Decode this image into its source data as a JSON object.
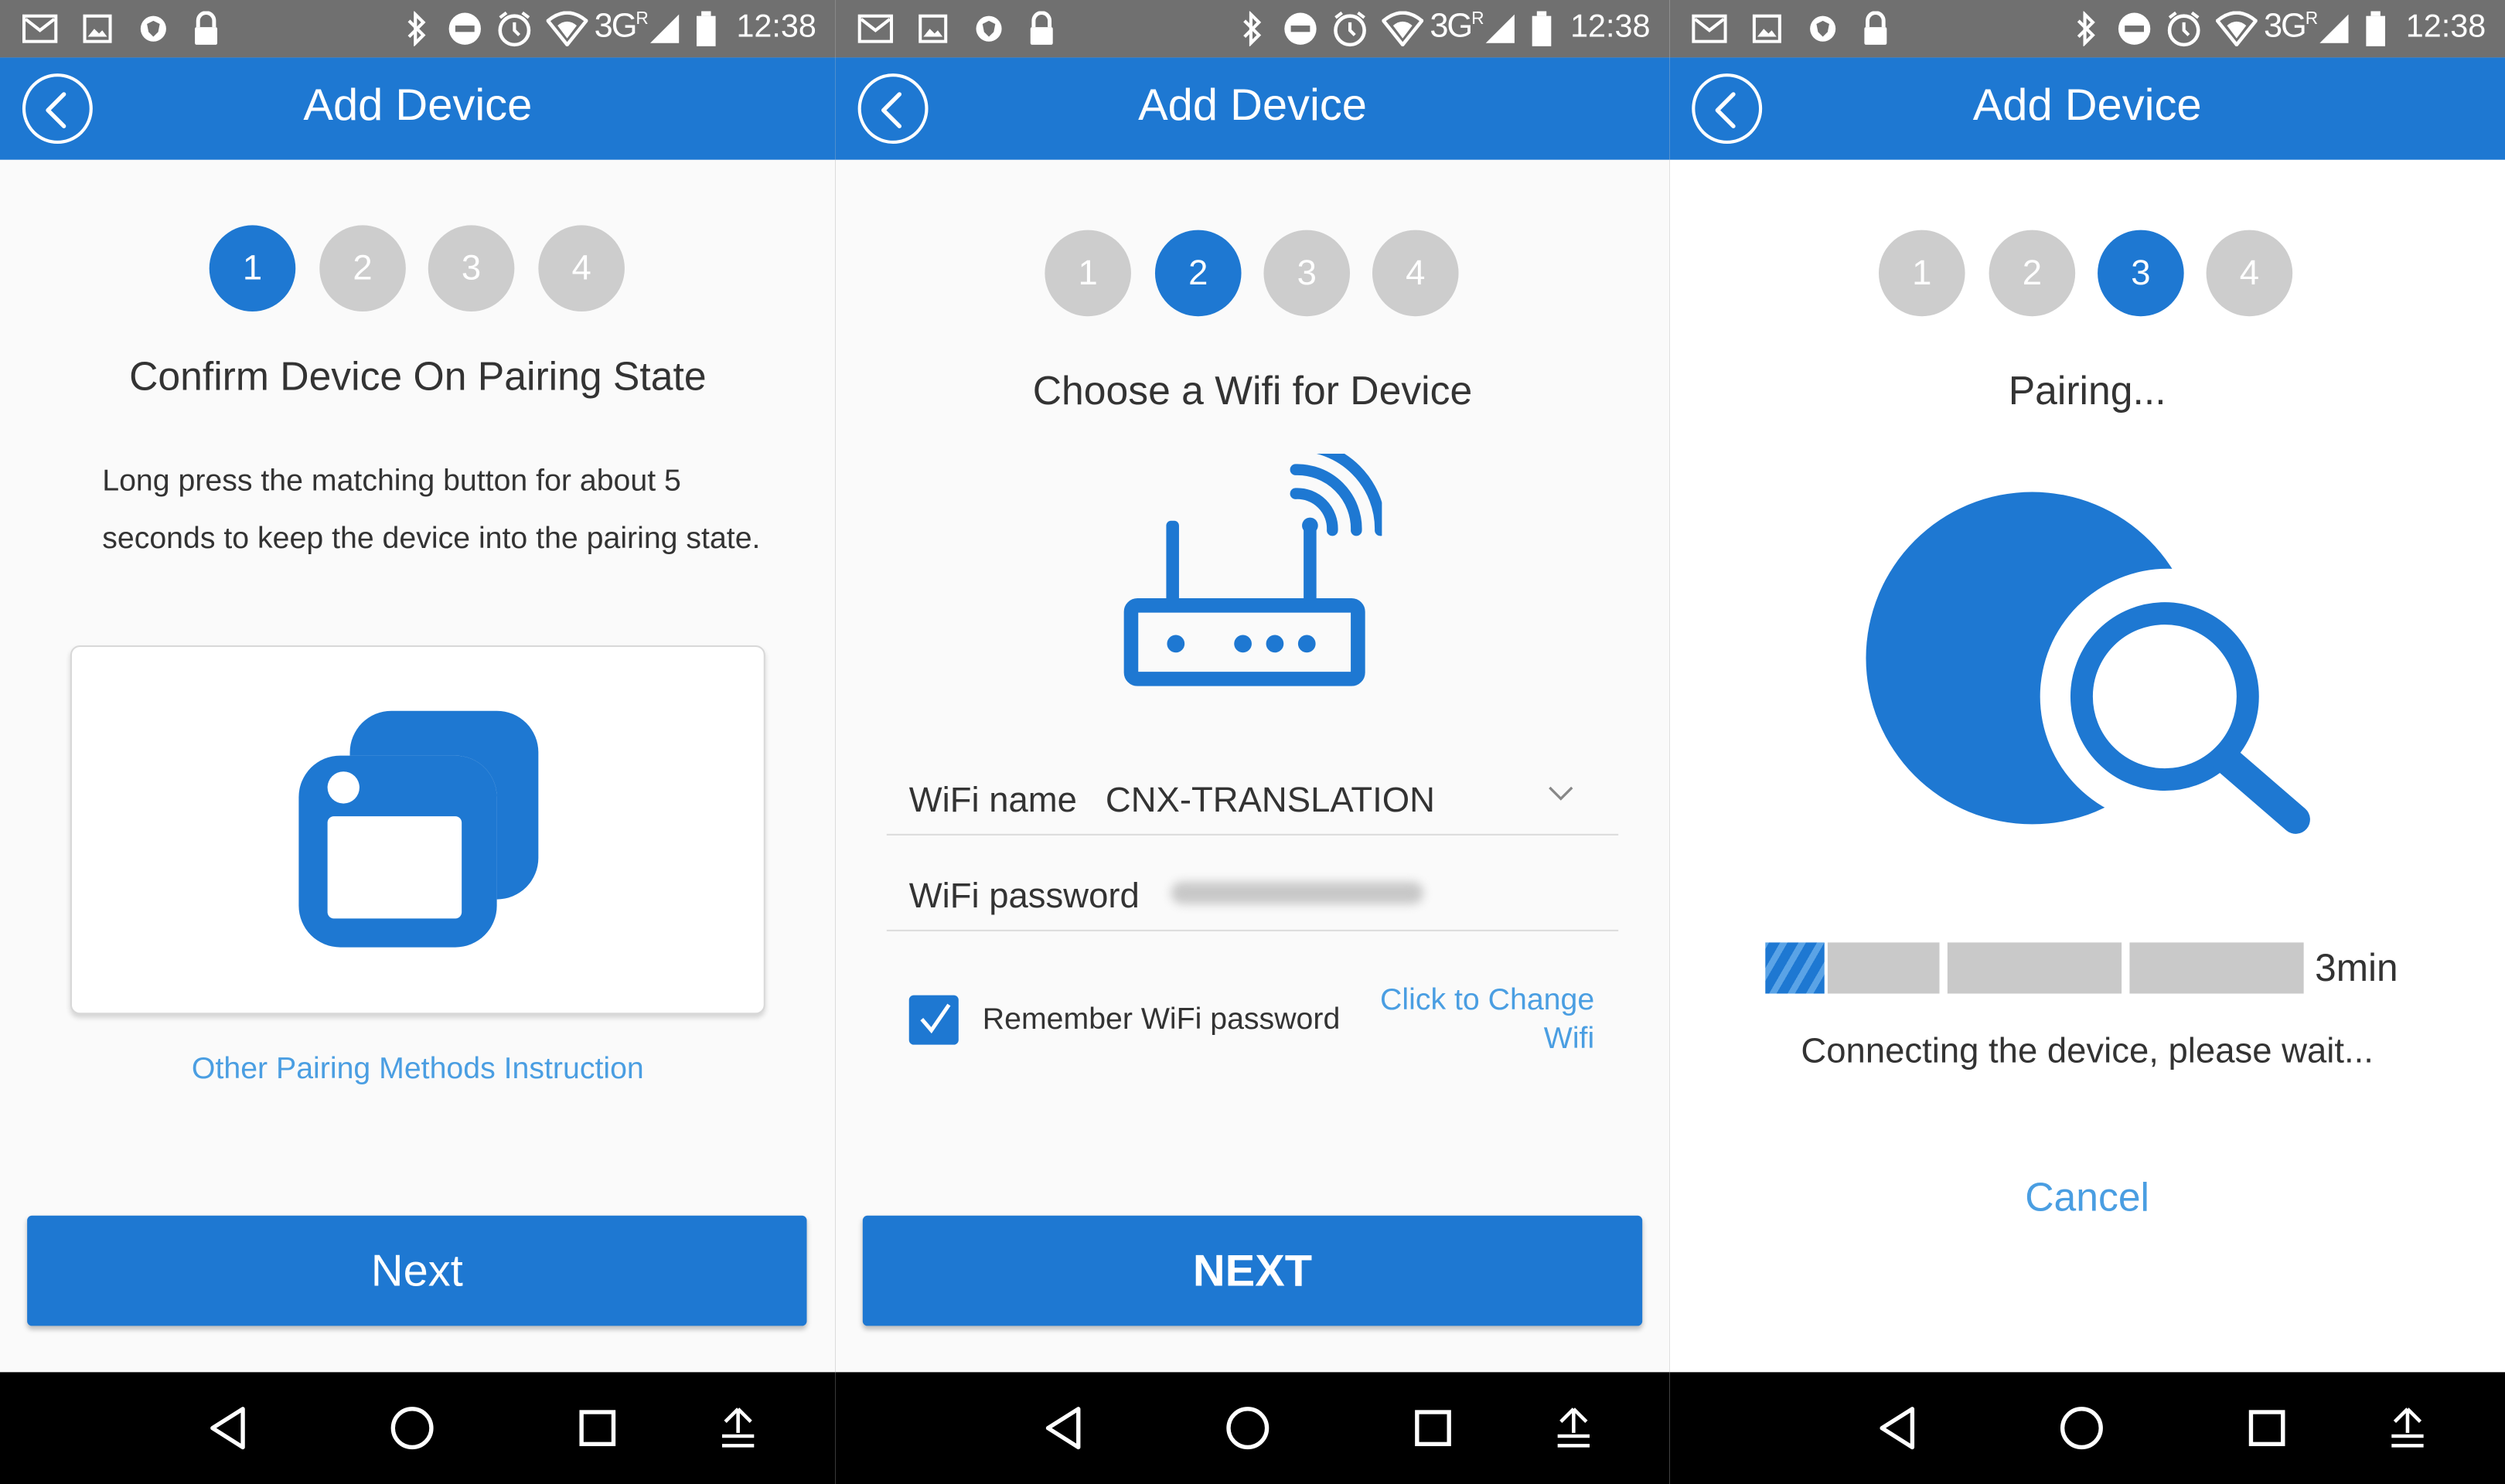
{
  "status_bar": {
    "network": "3G",
    "network_sup": "R",
    "time": "12:38",
    "icons": [
      "gmail-icon",
      "gallery-icon",
      "shield-icon",
      "lock-icon",
      "bluetooth-icon",
      "dnd-icon",
      "alarm-icon",
      "wifi-icon",
      "signal-icon",
      "battery-icon"
    ]
  },
  "screens": [
    {
      "title": "Add Device",
      "steps": [
        "1",
        "2",
        "3",
        "4"
      ],
      "active_step": 1,
      "heading": "Confirm Device On Pairing State",
      "description": "Long press the matching button for about 5 seconds to keep the device into the pairing state.",
      "link": "Other Pairing Methods Instruction",
      "button": "Next"
    },
    {
      "title": "Add Device",
      "steps": [
        "1",
        "2",
        "3",
        "4"
      ],
      "active_step": 2,
      "heading": "Choose a Wifi for Device",
      "wifi_name_label": "WiFi name",
      "wifi_name_value": "CNX-TRANSLATION",
      "wifi_password_label": "WiFi password",
      "remember_label": "Remember WiFi password",
      "remember_checked": true,
      "change_link": "Click to Change Wifi",
      "button": "NEXT"
    },
    {
      "title": "Add Device",
      "steps": [
        "1",
        "2",
        "3",
        "4"
      ],
      "active_step": 3,
      "heading": "Pairing...",
      "progress": 0.11,
      "remaining": "3min",
      "status": "Connecting the device, please wait...",
      "cancel": "Cancel"
    }
  ],
  "colors": {
    "accent": "#1e78d2",
    "link": "#4a9ee2",
    "inactive_step": "#cdcdcd",
    "status_bar": "#707070"
  }
}
